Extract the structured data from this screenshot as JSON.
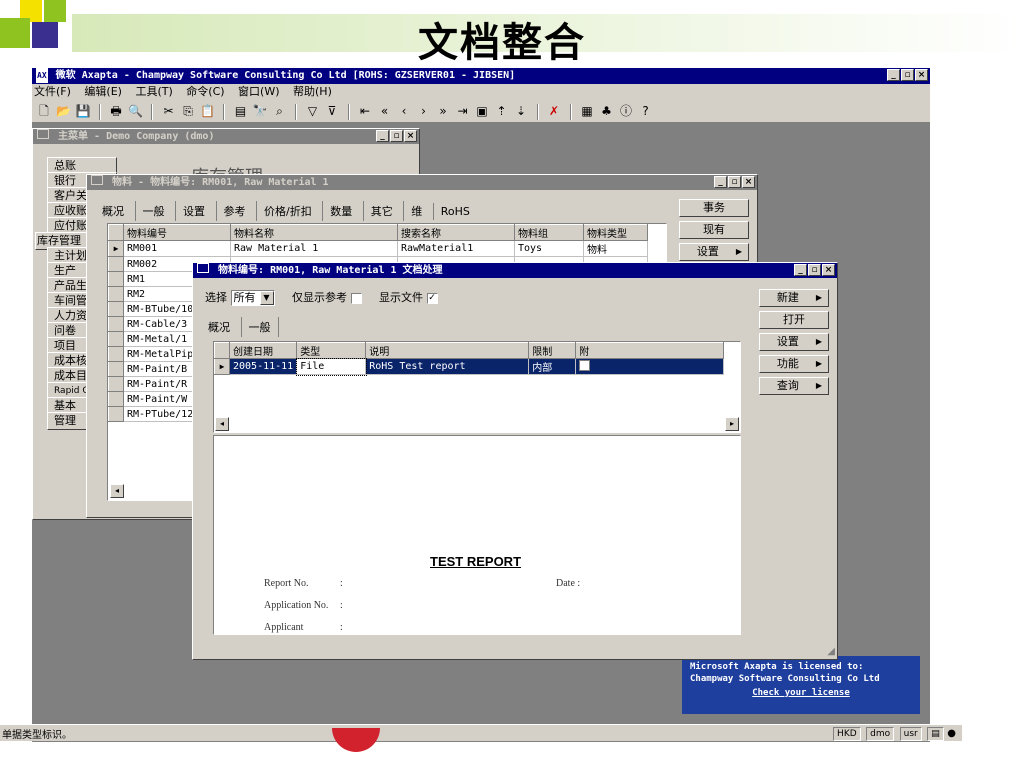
{
  "slide": {
    "title": "文档整合"
  },
  "app": {
    "title": "微软 Axapta - Champway Software Consulting Co Ltd [ROHS: GZSERVER01 - JIBSEN]",
    "menu": [
      "文件(F)",
      "编辑(E)",
      "工具(T)",
      "命令(C)",
      "窗口(W)",
      "帮助(H)"
    ],
    "status_text": "单据类型标识。",
    "status_boxes": [
      "HKD",
      "dmo",
      "usr"
    ],
    "license": {
      "line1": "Microsoft Axapta is licensed to:",
      "line2": "Champway Software Consulting Co Ltd",
      "link": "Check your license"
    }
  },
  "main_menu": {
    "title": "主菜单 - Demo Company (dmo)",
    "heading": "库存管理",
    "items": [
      "总账",
      "银行",
      "客户关系",
      "应收账",
      "应付账",
      "库存管理",
      "主计划",
      "生产",
      "产品生命",
      "车间管理",
      "人力资源",
      "问卷",
      "项目",
      "成本核算",
      "成本目标",
      "Rapid Config",
      "基本",
      "管理"
    ]
  },
  "items_form": {
    "title": "物料 - 物料编号: RM001, Raw Material 1",
    "tabs": [
      "概况",
      "一般",
      "设置",
      "参考",
      "价格/折扣",
      "数量",
      "其它",
      "维",
      "RoHS"
    ],
    "columns": [
      "物料编号",
      "物料名称",
      "搜索名称",
      "物料组",
      "物料类型"
    ],
    "rows": [
      [
        "RM001",
        "Raw Material 1",
        "RawMaterial1",
        "Toys",
        "物料"
      ],
      [
        "RM002",
        "",
        "",
        "",
        ""
      ],
      [
        "RM1",
        "",
        "",
        "",
        ""
      ],
      [
        "RM2",
        "",
        "",
        "",
        ""
      ],
      [
        "RM-BTube/10",
        "",
        "",
        "",
        ""
      ],
      [
        "RM-Cable/3",
        "",
        "",
        "",
        ""
      ],
      [
        "RM-Metal/1",
        "",
        "",
        "",
        ""
      ],
      [
        "RM-MetalPipe",
        "",
        "",
        "",
        ""
      ],
      [
        "RM-Paint/B",
        "",
        "",
        "",
        ""
      ],
      [
        "RM-Paint/R",
        "",
        "",
        "",
        ""
      ],
      [
        "RM-Paint/W",
        "",
        "",
        "",
        ""
      ],
      [
        "RM-PTube/12",
        "",
        "",
        "",
        ""
      ]
    ],
    "buttons": [
      "事务",
      "现有",
      "设置"
    ]
  },
  "doc_form": {
    "title": "物料编号: RM001, Raw Material 1 文档处理",
    "select_label": "选择",
    "select_value": "所有",
    "only_ref_label": "仅显示参考",
    "show_file_label": "显示文件",
    "tabs": [
      "概况",
      "一般"
    ],
    "columns": [
      "创建日期",
      "类型",
      "说明",
      "限制",
      "附"
    ],
    "rows": [
      [
        "2005-11-11",
        "File",
        "RoHS Test report",
        "内部",
        ""
      ]
    ],
    "buttons": [
      "新建",
      "打开",
      "设置",
      "功能",
      "查询"
    ],
    "report": {
      "title": "TEST REPORT",
      "report_no": "Report No.",
      "date": "Date :",
      "application_no": "Application No.",
      "applicant": "Applicant",
      "colon": ":"
    }
  }
}
